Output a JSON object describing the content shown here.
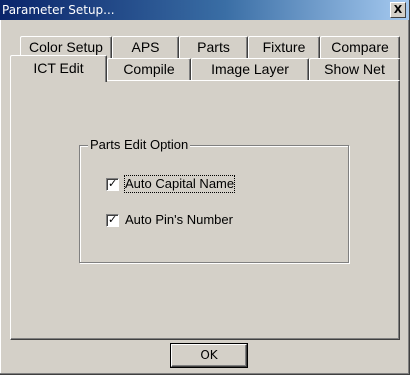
{
  "window": {
    "title": "Parameter Setup...",
    "close_glyph": "X"
  },
  "tabs": {
    "back_row": [
      "Color Setup",
      "APS",
      "Parts",
      "Fixture",
      "Compare"
    ],
    "front_row": [
      "ICT Edit",
      "Compile",
      "Image Layer",
      "Show Net"
    ],
    "active": "ICT Edit"
  },
  "group": {
    "legend": "Parts Edit Option",
    "options": [
      {
        "label": "Auto Capital Name",
        "checked": true
      },
      {
        "label": "Auto Pin's Number",
        "checked": true
      }
    ]
  },
  "buttons": {
    "ok_label": "OK"
  }
}
